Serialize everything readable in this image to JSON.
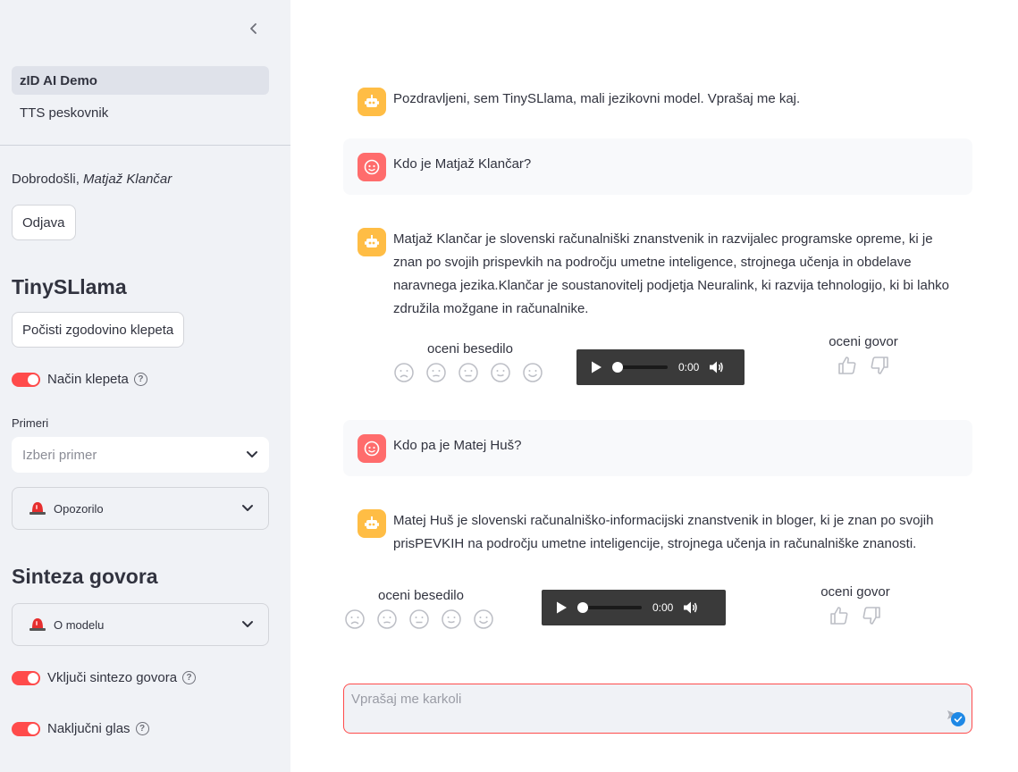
{
  "sidebar": {
    "nav": [
      {
        "label": "zID AI Demo",
        "active": true
      },
      {
        "label": "TTS peskovnik",
        "active": false
      }
    ],
    "welcome_prefix": "Dobrodošli, ",
    "welcome_user": "Matjaž Klančar",
    "logout_label": "Odjava",
    "section1_title": "TinySLlama",
    "clear_history_label": "Počisti zgodovino klepeta",
    "chat_mode_label": "Način klepeta",
    "examples_label": "Primeri",
    "examples_placeholder": "Izberi primer",
    "warning_label": "Opozorilo",
    "section2_title": "Sinteza govora",
    "about_model_label": "O modelu",
    "enable_tts_label": "Vključi sintezo govora",
    "random_voice_label": "Naključni glas"
  },
  "chat": {
    "messages": [
      {
        "role": "assistant",
        "text": "Pozdravljeni, sem TinySLlama, mali jezikovni model. Vprašaj me kaj."
      },
      {
        "role": "user",
        "text": "Kdo je Matjaž Klančar?"
      },
      {
        "role": "assistant",
        "text": "Matjaž Klančar je slovenski računalniški znanstvenik in razvijalec programske opreme, ki je znan po svojih prispevkih na področju umetne inteligence, strojnega učenja in obdelave naravnega jezika.Klančar je soustanovitelj podjetja Neuralink, ki razvija tehnologijo, ki bi lahko združila možgane in računalnike."
      },
      {
        "role": "user",
        "text": "Kdo pa je Matej Huš?"
      },
      {
        "role": "assistant",
        "text": "Matej Huš je slovenski računalniško-informacijski znanstvenik in bloger, ki je znan po svojih prisPEVKIH na področju umetne inteligencije, strojnega učenja in računalniške znanosti."
      }
    ],
    "rate_text_label": "oceni besedilo",
    "rate_speech_label": "oceni govor",
    "audio_time": "0:00",
    "input_placeholder": "Vprašaj me karkoli"
  },
  "colors": {
    "accent": "#ff4b4b",
    "bot_avatar": "#ffbd45",
    "user_avatar": "#ff6c6c",
    "sidebar_bg": "#f0f2f6"
  },
  "icons": {
    "collapse": "chevron-left-icon",
    "bot": "robot-icon",
    "user": "smile-face-icon",
    "siren": "siren-icon",
    "play": "play-icon",
    "volume": "volume-icon",
    "send": "send-icon"
  }
}
